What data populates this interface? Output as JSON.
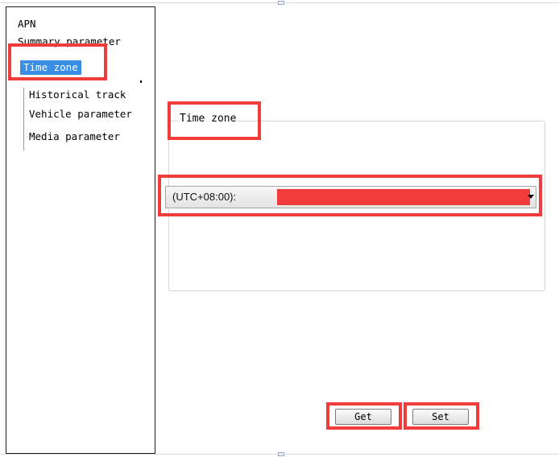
{
  "tree": {
    "items": [
      {
        "label": "APN"
      },
      {
        "label": "Summary parameter"
      },
      {
        "label": "Time zone",
        "selected": true
      },
      {
        "label": "Historical track"
      },
      {
        "label": "Vehicle parameter"
      },
      {
        "label": "Media parameter"
      }
    ]
  },
  "group": {
    "legend": "Time zone"
  },
  "timezone_select": {
    "value_prefix": "(UTC+08:00):",
    "redacted": true
  },
  "buttons": {
    "get_label": "Get",
    "set_label": "Set"
  },
  "colors": {
    "selection": "#3a8ee6",
    "annotation_red": "#f23b3b"
  },
  "icons": {
    "dropdown": "chevron-down-icon"
  }
}
